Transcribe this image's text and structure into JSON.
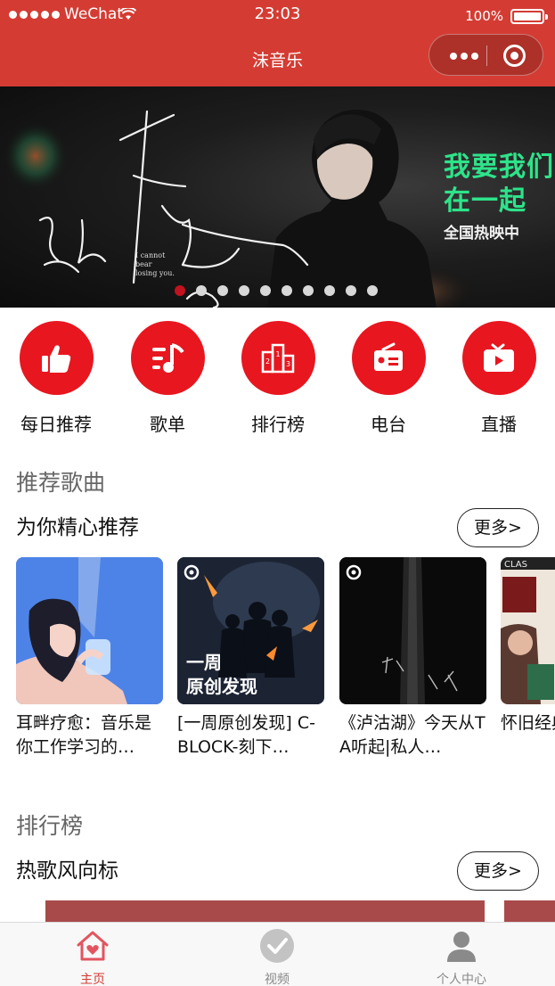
{
  "status_bar": {
    "carrier": "WeChat",
    "time": "23:03",
    "battery": "100%"
  },
  "nav": {
    "title": "沫音乐"
  },
  "banner": {
    "headline": "我要我们\n在一起",
    "subline": "全国热映中",
    "small_text": "I cannot\nbear\nlosing you.",
    "slide_count": 10,
    "active_slide": 1
  },
  "quick_nav": [
    {
      "label": "每日推荐",
      "icon": "thumbs-up-icon"
    },
    {
      "label": "歌单",
      "icon": "playlist-icon"
    },
    {
      "label": "排行榜",
      "icon": "podium-icon"
    },
    {
      "label": "电台",
      "icon": "radio-icon"
    },
    {
      "label": "直播",
      "icon": "live-tv-icon"
    }
  ],
  "recommend": {
    "title": "推荐歌曲",
    "subtitle": "为你精心推荐",
    "more": "更多>",
    "cards": [
      {
        "title": "耳畔疗愈：音乐是你工作学习的…"
      },
      {
        "title": "[一周原创发现] C-BLOCK-刻下…",
        "cover_text": "一周\n原创发现"
      },
      {
        "title": "《泸沽湖》今天从TA听起|私人…"
      },
      {
        "title": "怀旧经典 百听不厌"
      }
    ]
  },
  "ranking": {
    "title": "排行榜",
    "subtitle": "热歌风向标",
    "more": "更多>"
  },
  "tabbar": [
    {
      "label": "主页",
      "icon": "home-icon",
      "active": true
    },
    {
      "label": "视频",
      "icon": "video-check-icon",
      "active": false
    },
    {
      "label": "个人中心",
      "icon": "user-icon",
      "active": false
    }
  ],
  "colors": {
    "brand": "#d43c33",
    "icon_circle": "#e8161f",
    "banner_accent": "#2ee38a"
  }
}
